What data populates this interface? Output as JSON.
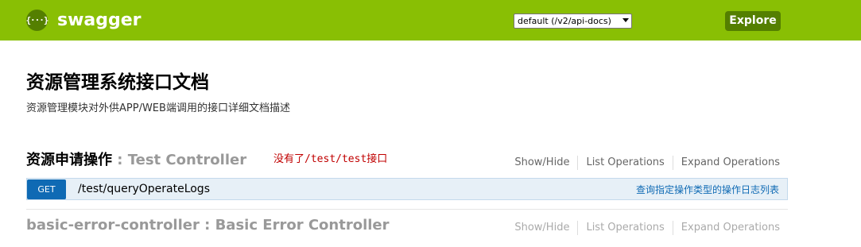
{
  "header": {
    "logo_glyph": "{···}",
    "logo_text": "swagger",
    "api_select_value": "default (/v2/api-docs)",
    "explore_label": "Explore",
    "bg_color": "#89bf04"
  },
  "page": {
    "title": "资源管理系统接口文档",
    "description": "资源管理模块对外供APP/WEB端调用的接口详细文档描述"
  },
  "resources": [
    {
      "name_zh": "资源申请操作",
      "name_en": " : Test Controller",
      "note_zh": "没有了",
      "note_path": "/test/test",
      "note_suffix": "接口",
      "ops": {
        "show_hide": "Show/Hide",
        "list": "List Operations",
        "expand": "Expand Operations"
      },
      "endpoints": [
        {
          "method": "GET",
          "path": "/test/queryOperateLogs",
          "summary": "查询指定操作类型的操作日志列表"
        }
      ]
    },
    {
      "name_en": "basic-error-controller : Basic Error Controller",
      "ops": {
        "show_hide": "Show/Hide",
        "list": "List Operations",
        "expand": "Expand Operations"
      }
    }
  ]
}
